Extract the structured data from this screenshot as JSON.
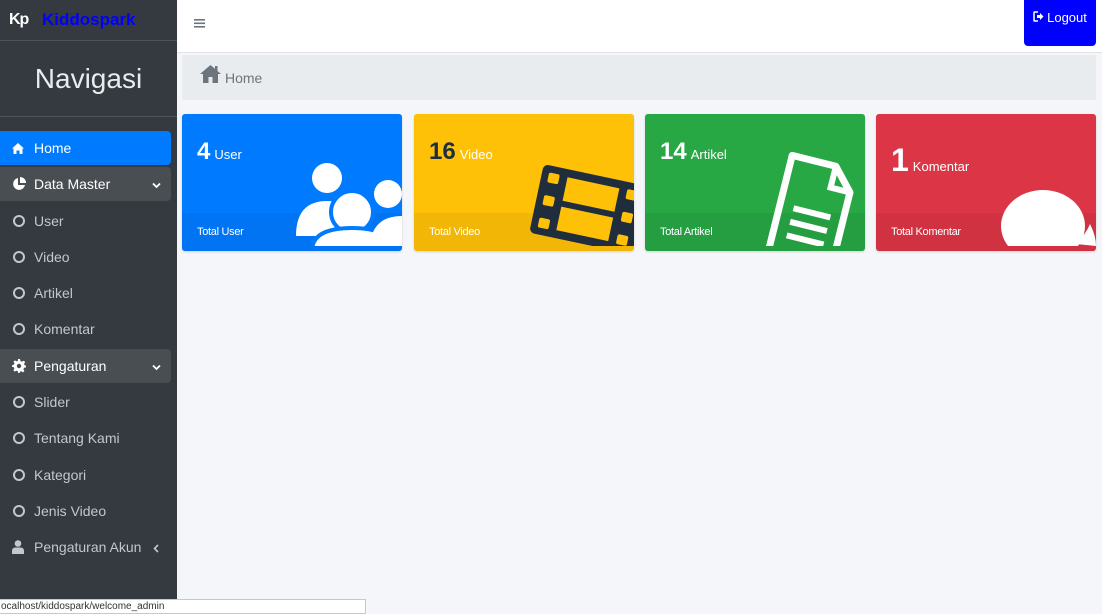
{
  "brand": {
    "logo": "Kp",
    "name": "Kiddospark",
    "name_color": "#0000ff"
  },
  "sidebar": {
    "title": "Navigasi",
    "items": [
      {
        "label": "Home",
        "icon": "home-icon",
        "state": "active"
      },
      {
        "label": "Data Master",
        "icon": "pie-chart-icon",
        "state": "open",
        "chevron": "chevron-down-icon"
      },
      {
        "label": "User",
        "icon": "circle-icon"
      },
      {
        "label": "Video",
        "icon": "circle-icon"
      },
      {
        "label": "Artikel",
        "icon": "circle-icon"
      },
      {
        "label": "Komentar",
        "icon": "circle-icon"
      },
      {
        "label": "Pengaturan",
        "icon": "gear-icon",
        "state": "open",
        "chevron": "chevron-down-icon"
      },
      {
        "label": "Slider",
        "icon": "circle-icon"
      },
      {
        "label": "Tentang Kami",
        "icon": "circle-icon"
      },
      {
        "label": "Kategori",
        "icon": "circle-icon"
      },
      {
        "label": "Jenis Video",
        "icon": "circle-icon"
      },
      {
        "label": "Pengaturan Akun",
        "icon": "user-icon",
        "chevron": "chevron-left-icon"
      }
    ]
  },
  "topbar": {
    "menu_icon": "hamburger-icon",
    "logout_label": "Logout",
    "logout_icon": "sign-out-icon"
  },
  "breadcrumb": {
    "label": "Home",
    "icon": "home-icon"
  },
  "cards": [
    {
      "count": "4",
      "unit": "User",
      "footer": "Total User",
      "color": "#007bff",
      "icon": "users-icon"
    },
    {
      "count": "16",
      "unit": "Video",
      "footer": "Total Video",
      "color": "#ffc107",
      "icon": "film-icon"
    },
    {
      "count": "14",
      "unit": "Artikel",
      "footer": "Total Artikel",
      "color": "#28a745",
      "icon": "document-icon"
    },
    {
      "count": "1",
      "unit": "Komentar",
      "footer": "Total Komentar",
      "color": "#dc3545",
      "icon": "comment-icon"
    }
  ],
  "statusbar": {
    "url": "ocalhost/kiddospark/welcome_admin"
  }
}
